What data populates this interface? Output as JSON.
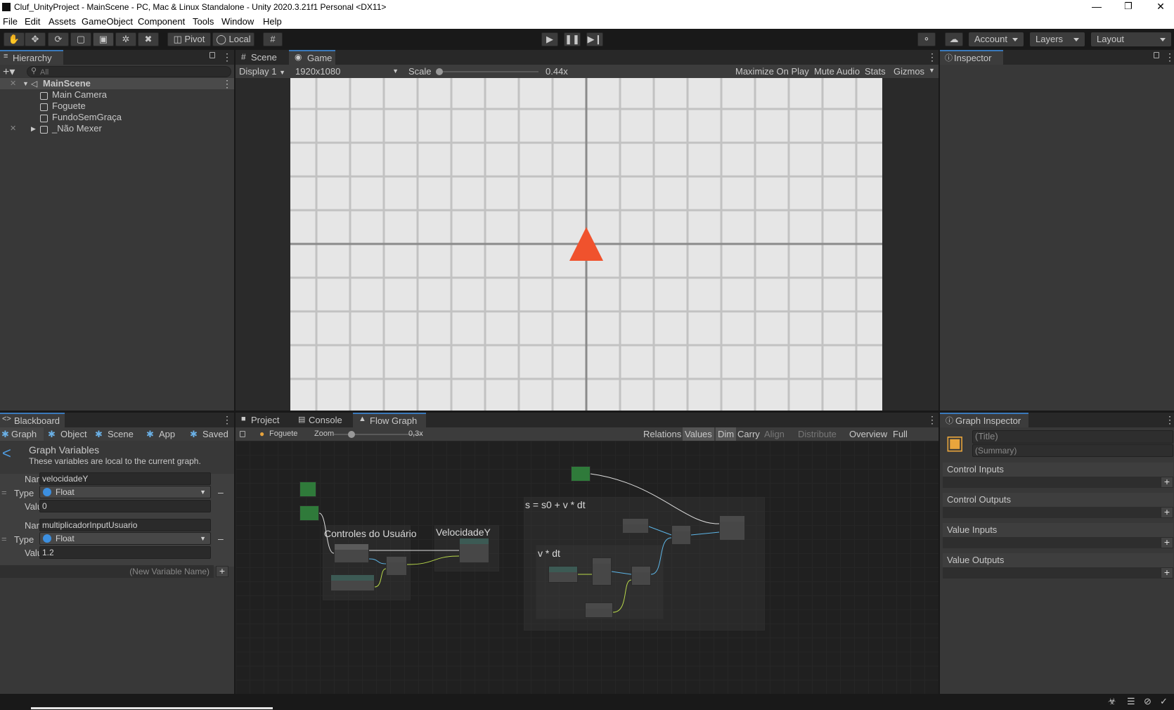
{
  "window": {
    "title": "Cluf_UnityProject - MainScene - PC, Mac & Linux Standalone - Unity 2020.3.21f1 Personal <DX11>"
  },
  "menu": [
    "File",
    "Edit",
    "Assets",
    "GameObject",
    "Component",
    "Tools",
    "Window",
    "Help"
  ],
  "toolbar": {
    "pivot": "Pivot",
    "local": "Local",
    "account": "Account",
    "layers": "Layers",
    "layout": "Layout"
  },
  "hierarchy": {
    "tab": "Hierarchy",
    "search_placeholder": "All",
    "scene": "MainScene",
    "items": [
      "Main Camera",
      "Foguete",
      "FundoSemGraça",
      "_Não Mexer"
    ]
  },
  "center_tabs": {
    "scene": "Scene",
    "game": "Game"
  },
  "game_toolbar": {
    "display": "Display 1",
    "resolution": "1920x1080",
    "scale_label": "Scale",
    "scale_value": "0.44x",
    "scale_fraction": 0.0,
    "maximize": "Maximize On Play",
    "mute": "Mute Audio",
    "stats": "Stats",
    "gizmos": "Gizmos"
  },
  "game_colors": {
    "background": "#e6e6e6",
    "grid": "#c2c2c2",
    "axis": "#8a8a8a",
    "rocket": "#f0522d"
  },
  "inspector": {
    "tab": "Inspector"
  },
  "blackboard": {
    "tab": "Blackboard",
    "scopes": [
      "Graph",
      "Object",
      "Scene",
      "App",
      "Saved"
    ],
    "header_title": "Graph Variables",
    "header_desc": "These variables are local to the current graph.",
    "labels": {
      "name": "Name",
      "type": "Type",
      "value": "Value"
    },
    "variables": [
      {
        "name": "velocidadeY",
        "type": "Float",
        "value": "0"
      },
      {
        "name": "multiplicadorInputUsuario",
        "type": "Float",
        "value": "1.2"
      }
    ],
    "new_var_placeholder": "(New Variable Name)"
  },
  "bottom_tabs": {
    "project": "Project",
    "console": "Console",
    "flow": "Flow Graph"
  },
  "flow_toolbar": {
    "object": "Foguete",
    "zoom_label": "Zoom",
    "zoom_value": "0,3x",
    "zoom_fraction": 0.2,
    "buttons": [
      "Relations",
      "Values",
      "Dim",
      "Carry",
      "Align",
      "Distribute",
      "Overview",
      "Full Screen"
    ]
  },
  "graph_groups": [
    "Controles do Usuário",
    "VelocidadeY",
    "s = s0 + v * dt",
    "v * dt"
  ],
  "graph_inspector": {
    "tab": "Graph Inspector",
    "title_placeholder": "(Title)",
    "summary_placeholder": "(Summary)",
    "sections": [
      "Control Inputs",
      "Control Outputs",
      "Value Inputs",
      "Value Outputs"
    ]
  }
}
